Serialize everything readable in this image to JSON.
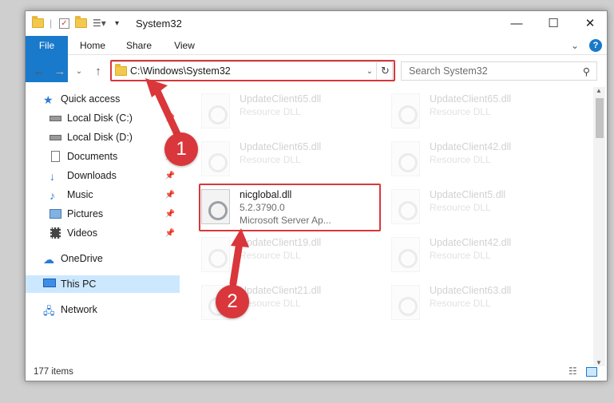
{
  "window": {
    "title": "System32"
  },
  "ribbon": {
    "tabs": [
      "File",
      "Home",
      "Share",
      "View"
    ],
    "help": "?"
  },
  "address": {
    "path": "C:\\Windows\\System32",
    "search_placeholder": "Search System32"
  },
  "nav": {
    "items": [
      {
        "label": "Quick access",
        "icon": "star-icon"
      },
      {
        "label": "Local Disk (C:)",
        "icon": "drive-icon"
      },
      {
        "label": "Local Disk (D:)",
        "icon": "drive-icon"
      },
      {
        "label": "Documents",
        "icon": "documents-icon"
      },
      {
        "label": "Downloads",
        "icon": "download-icon"
      },
      {
        "label": "Music",
        "icon": "music-icon"
      },
      {
        "label": "Pictures",
        "icon": "pictures-icon"
      },
      {
        "label": "Videos",
        "icon": "videos-icon"
      },
      {
        "label": "OneDrive",
        "icon": "cloud-icon"
      },
      {
        "label": "This PC",
        "icon": "computer-icon"
      },
      {
        "label": "Network",
        "icon": "network-icon"
      }
    ]
  },
  "files": [
    {
      "name": "UpdateClient65.dll",
      "line2": "Resource DLL",
      "line3": ""
    },
    {
      "name": "UpdateClient65.dll",
      "line2": "Resource DLL",
      "line3": ""
    },
    {
      "name": "UpdateClient65.dll",
      "line2": "Resource DLL",
      "line3": ""
    },
    {
      "name": "UpdateClient42.dll",
      "line2": "Resource DLL",
      "line3": ""
    },
    {
      "name": "nicglobal.dll",
      "line2": "5.2.3790.0",
      "line3": "Microsoft Server Ap..."
    },
    {
      "name": "UpdateClient5.dll",
      "line2": "Resource DLL",
      "line3": ""
    },
    {
      "name": "UpdateClient19.dll",
      "line2": "Resource DLL",
      "line3": ""
    },
    {
      "name": "UpdateClient42.dll",
      "line2": "Resource DLL",
      "line3": ""
    },
    {
      "name": "UpdateClient21.dll",
      "line2": "Resource DLL",
      "line3": ""
    },
    {
      "name": "UpdateClient63.dll",
      "line2": "Resource DLL",
      "line3": ""
    }
  ],
  "status": {
    "count": "177 items"
  },
  "annotations": {
    "marker1": "1",
    "marker2": "2"
  },
  "colors": {
    "accent": "#1979ca",
    "highlight": "#d9373b",
    "selection": "#cce8ff"
  }
}
